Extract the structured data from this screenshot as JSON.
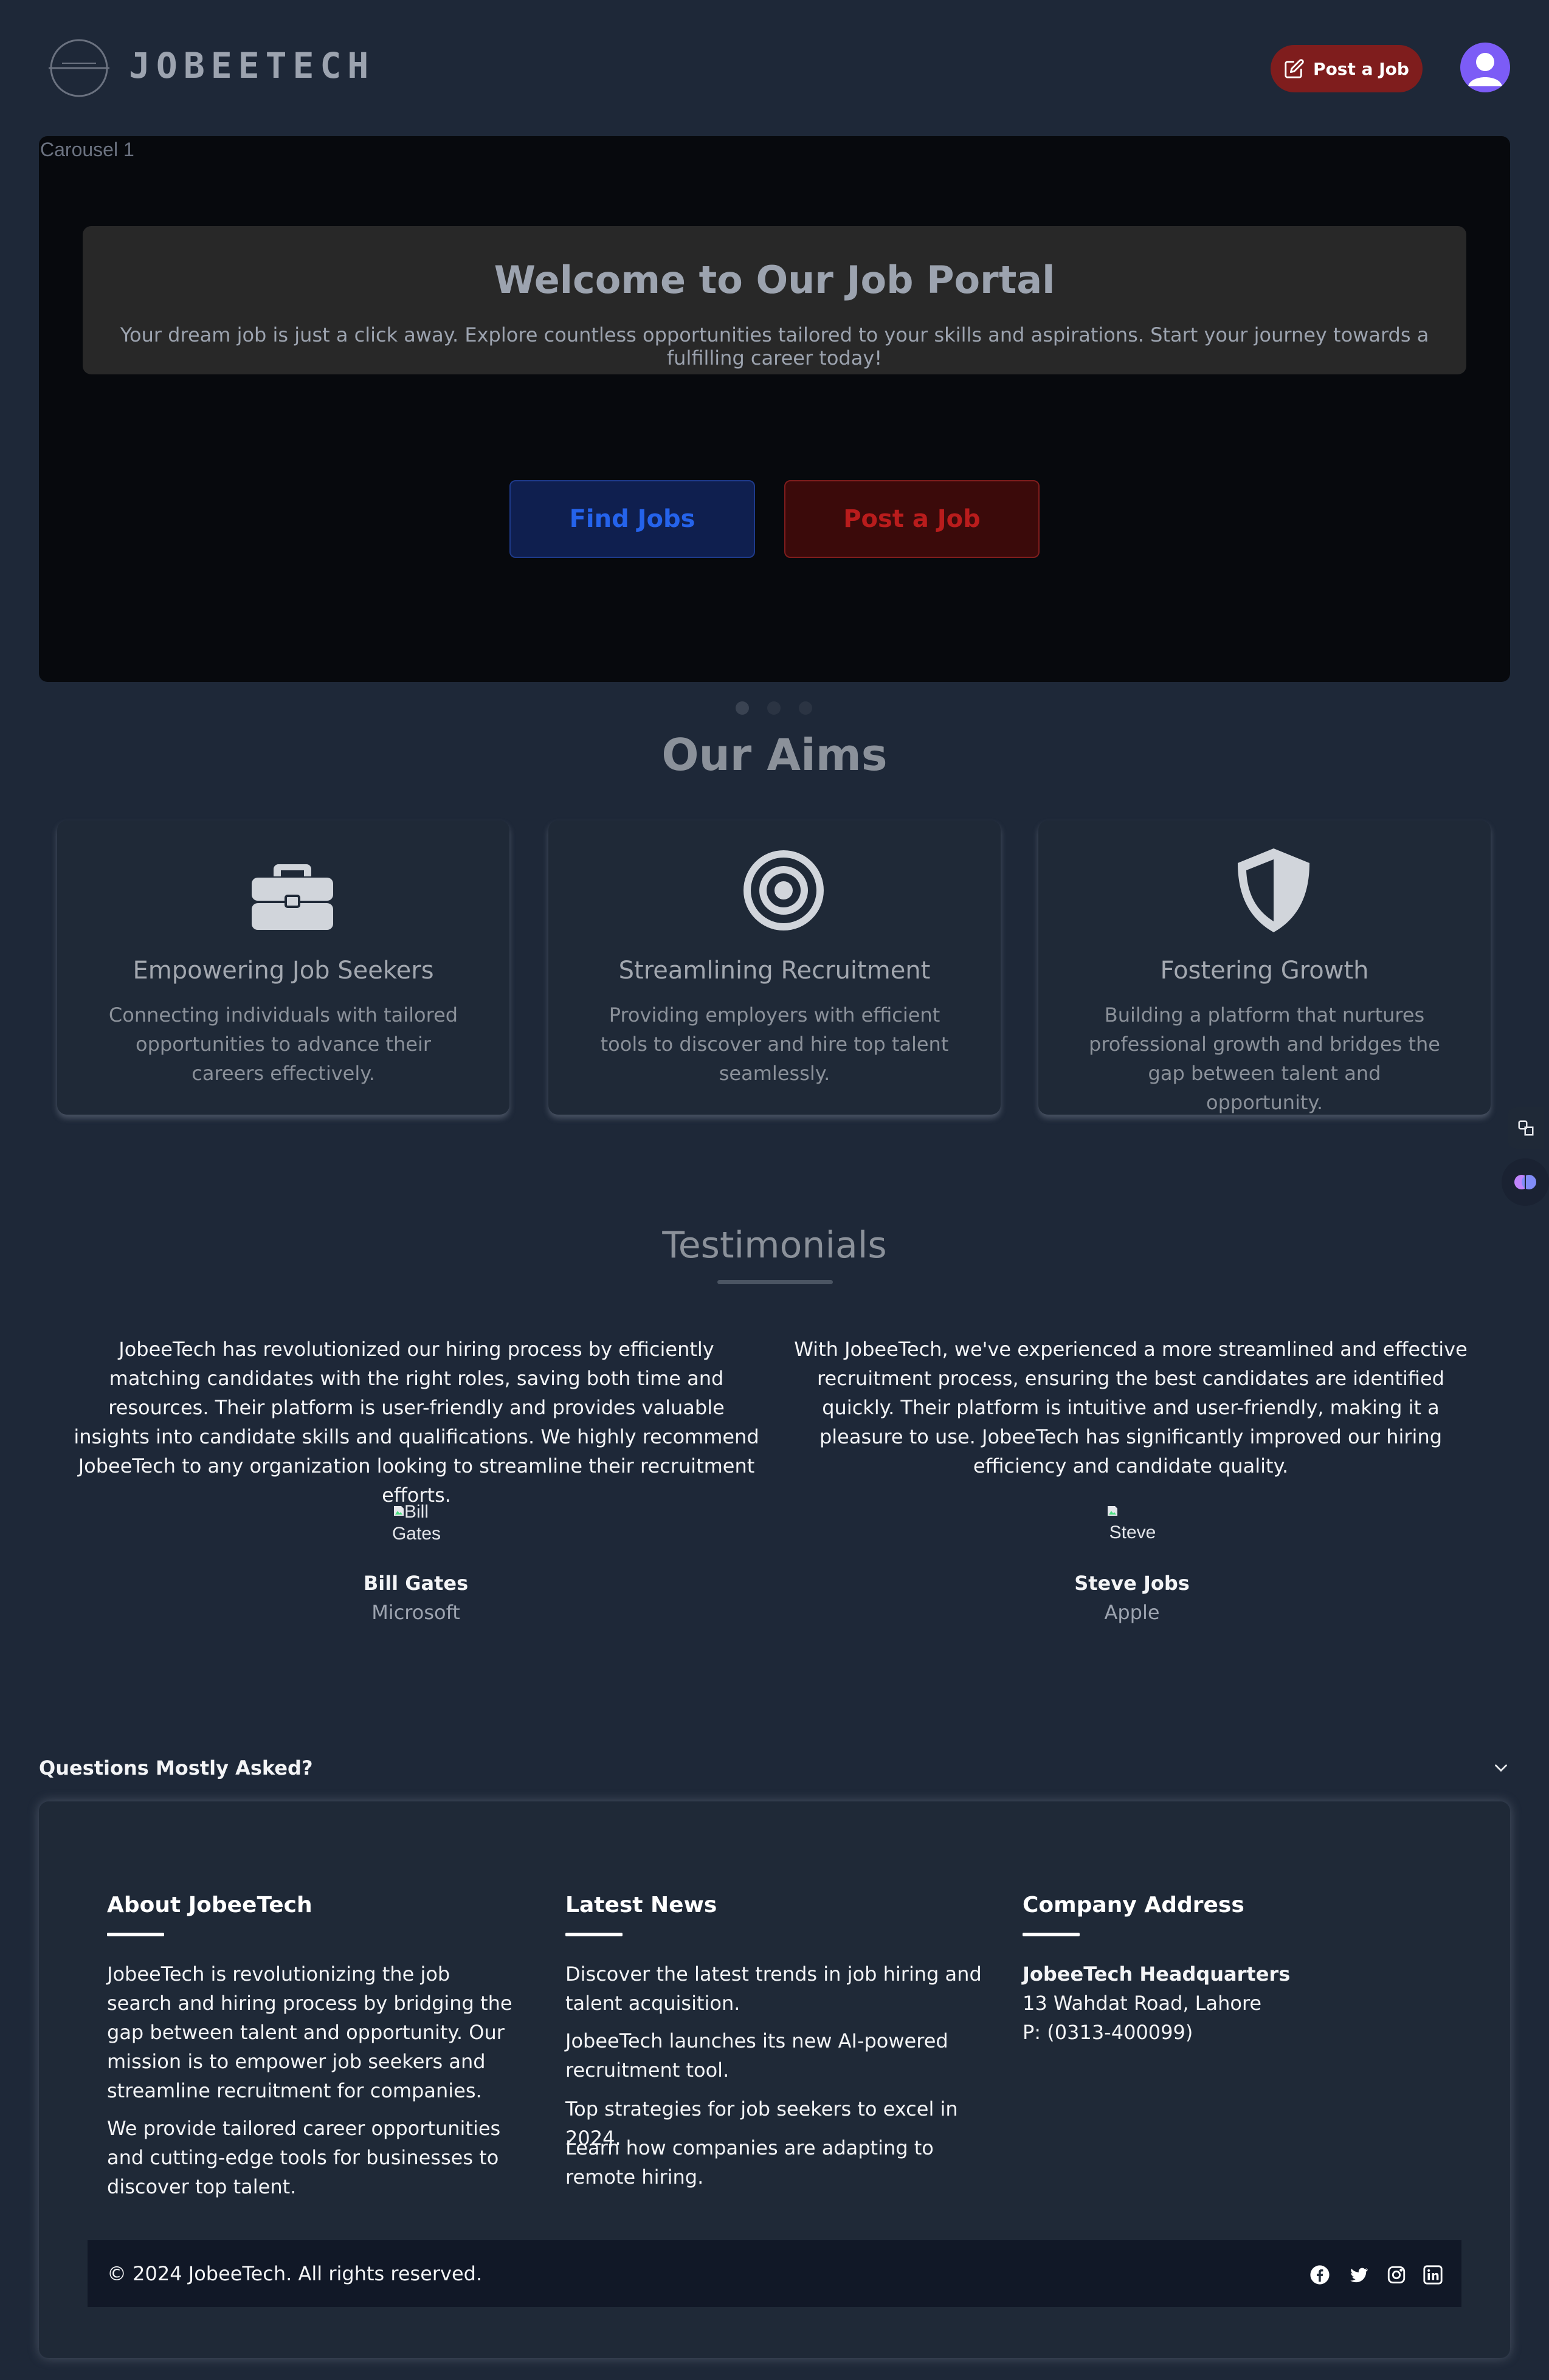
{
  "header": {
    "logo_text": "JOBEETECH",
    "post_job_label": "Post a Job"
  },
  "carousel": {
    "image_alt": "Carousel 1",
    "title": "Welcome to Our Job Portal",
    "subtitle": "Your dream job is just a click away. Explore countless opportunities tailored to your skills and aspirations. Start your journey towards a fulfilling career today!",
    "find_jobs_label": "Find Jobs",
    "post_job_label": "Post a Job",
    "slides": 3,
    "active_slide": 1
  },
  "aims": {
    "title": "Our Aims",
    "cards": [
      {
        "icon": "briefcase-icon",
        "title": "Empowering Job Seekers",
        "desc": "Connecting individuals with tailored opportunities to advance their careers effectively."
      },
      {
        "icon": "target-icon",
        "title": "Streamlining Recruitment",
        "desc": "Providing employers with efficient tools to discover and hire top talent seamlessly."
      },
      {
        "icon": "shield-icon",
        "title": "Fostering Growth",
        "desc": "Building a platform that nurtures professional growth and bridges the gap between talent and opportunity."
      }
    ]
  },
  "testimonials": {
    "title": "Testimonials",
    "items": [
      {
        "quote": "JobeeTech has revolutionized our hiring process by efficiently matching candidates with the right roles, saving both time and resources. Their platform is user-friendly and provides valuable insights into candidate skills and qualifications. We highly recommend JobeeTech to any organization looking to streamline their recruitment efforts.",
        "img_alt": "Bill Gates",
        "name": "Bill Gates",
        "company": "Microsoft"
      },
      {
        "quote": "With JobeeTech, we've experienced a more streamlined and effective recruitment process, ensuring the best candidates are identified quickly. Their platform is intuitive and user-friendly, making it a pleasure to use. JobeeTech has significantly improved our hiring efficiency and candidate quality.",
        "img_alt": "Steve",
        "name": "Steve Jobs",
        "company": "Apple"
      }
    ]
  },
  "faq": {
    "question": "Questions Mostly Asked?"
  },
  "footer": {
    "about": {
      "heading": "About JobeeTech",
      "p1": "JobeeTech is revolutionizing the job search and hiring process by bridging the gap between talent and opportunity. Our mission is to empower job seekers and streamline recruitment for companies.",
      "p2": "We provide tailored career opportunities and cutting-edge tools for businesses to discover top talent."
    },
    "news": {
      "heading": "Latest News",
      "items": [
        "Discover the latest trends in job hiring and talent acquisition.",
        "JobeeTech launches its new AI-powered recruitment tool.",
        "Top strategies for job seekers to excel in 2024.",
        "Learn how companies are adapting to remote hiring."
      ]
    },
    "address": {
      "heading": "Company Address",
      "name": "JobeeTech Headquarters",
      "street": "13 Wahdat Road, Lahore",
      "phone": "P: (0313-400099)"
    },
    "copyright": "© 2024 JobeeTech. All rights reserved.",
    "social": [
      "facebook-icon",
      "twitter-icon",
      "instagram-icon",
      "linkedin-icon"
    ]
  }
}
